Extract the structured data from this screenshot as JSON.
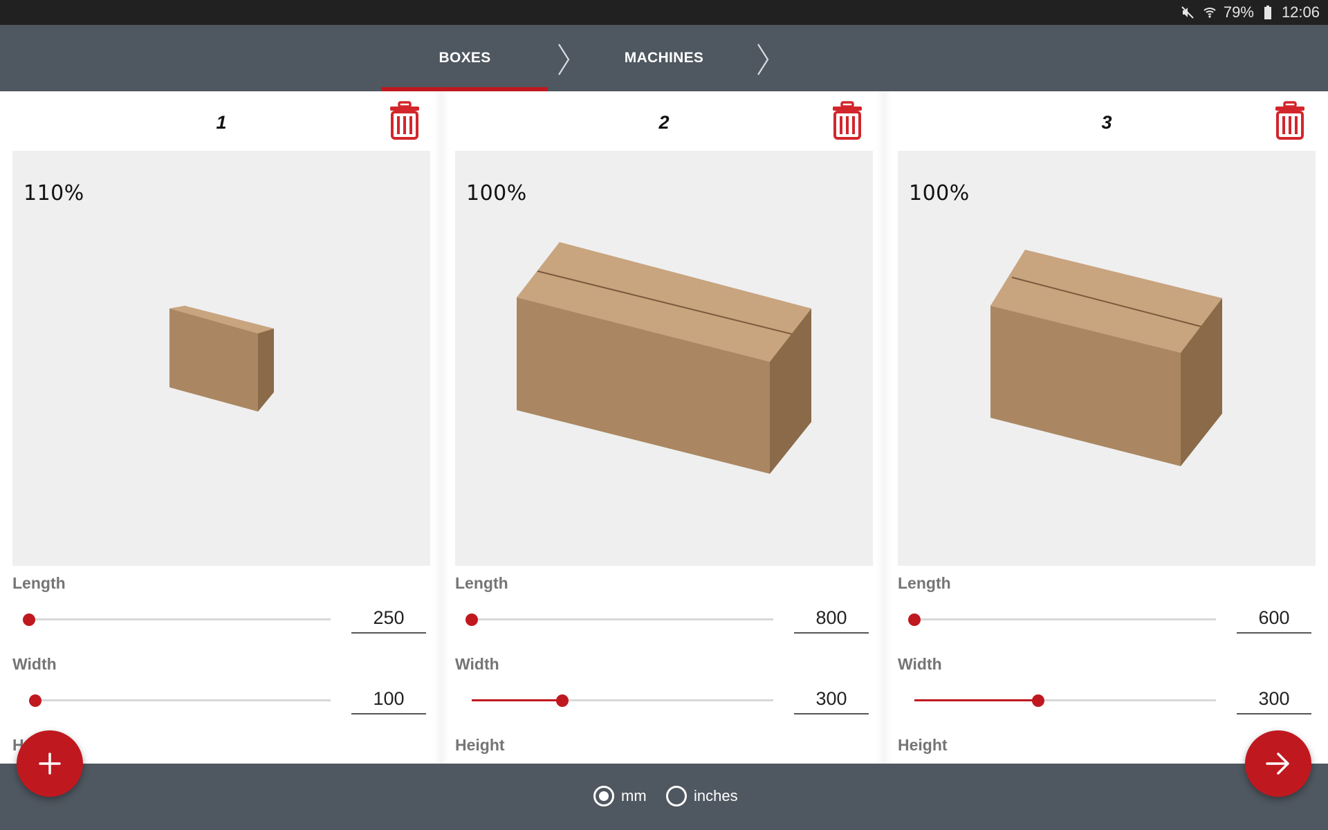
{
  "status_bar": {
    "icons": [
      "mute-icon",
      "wifi-icon",
      "battery-icon"
    ],
    "battery_percent": "79%",
    "time": "12:06"
  },
  "nav": {
    "tabs": [
      {
        "label": "BOXES",
        "active": true
      },
      {
        "label": "MACHINES",
        "active": false
      }
    ],
    "accent_color": "#c0181f"
  },
  "boxes": [
    {
      "title": "1",
      "zoom": "110%",
      "dimensions": {
        "length": {
          "label": "Length",
          "value": "250",
          "slider_fraction": 0.0
        },
        "width": {
          "label": "Width",
          "value": "100",
          "slider_fraction": 0.02
        },
        "height": {
          "label": "Height"
        }
      }
    },
    {
      "title": "2",
      "zoom": "100%",
      "dimensions": {
        "length": {
          "label": "Length",
          "value": "800",
          "slider_fraction": 0.0
        },
        "width": {
          "label": "Width",
          "value": "300",
          "slider_fraction": 0.3
        },
        "height": {
          "label": "Height"
        }
      }
    },
    {
      "title": "3",
      "zoom": "100%",
      "dimensions": {
        "length": {
          "label": "Length",
          "value": "600",
          "slider_fraction": 0.0
        },
        "width": {
          "label": "Width",
          "value": "300",
          "slider_fraction": 0.41
        },
        "height": {
          "label": "Height"
        }
      }
    }
  ],
  "units": {
    "options": [
      {
        "label": "mm",
        "selected": true
      },
      {
        "label": "inches",
        "selected": false
      }
    ]
  },
  "fabs": {
    "add": "plus-icon",
    "next": "arrow-right-icon"
  }
}
